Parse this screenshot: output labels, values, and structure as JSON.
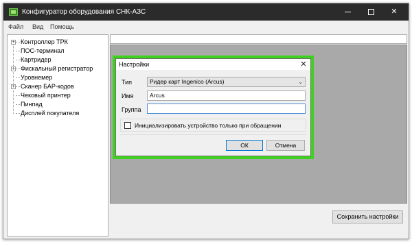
{
  "window": {
    "title": "Конфигуратор оборудования СНК-АЗС",
    "minimize_glyph": "—",
    "close_glyph": "✕"
  },
  "menu": [
    "Файл",
    "Вид",
    "Помощь"
  ],
  "tree": {
    "items": [
      {
        "label": "Контроллер ТРК",
        "expandable": true
      },
      {
        "label": "ПОС-терминал",
        "expandable": false
      },
      {
        "label": "Картридер",
        "expandable": false
      },
      {
        "label": "Фискальный регистратор",
        "expandable": true
      },
      {
        "label": "Уровнемер",
        "expandable": false
      },
      {
        "label": "Сканер БАР-кодов",
        "expandable": true
      },
      {
        "label": "Чековый принтер",
        "expandable": false
      },
      {
        "label": "Пинпад",
        "expandable": false
      },
      {
        "label": "Дисплей покупателя",
        "expandable": false
      }
    ],
    "expander_glyph": "+"
  },
  "dialog": {
    "title": "Настройки",
    "close_glyph": "✕",
    "type_label": "Тип",
    "type_value": "Ридер карт Ingenico (Arcus)",
    "name_label": "Имя",
    "name_value": "Arcus",
    "group_label": "Группа",
    "group_value": "",
    "checkbox_label": "Инициализировать устройство только при обращении",
    "checkbox_checked": false,
    "ok_label": "ОК",
    "cancel_label": "Отмена",
    "highlight_color": "#3ed120"
  },
  "footer": {
    "save_label": "Сохранить настройки"
  },
  "icons": {
    "dropdown": "chevron-down-icon",
    "window_close": "close-icon",
    "window_maximize": "maximize-icon",
    "window_minimize": "minimize-icon",
    "app": "app-logo-icon"
  }
}
